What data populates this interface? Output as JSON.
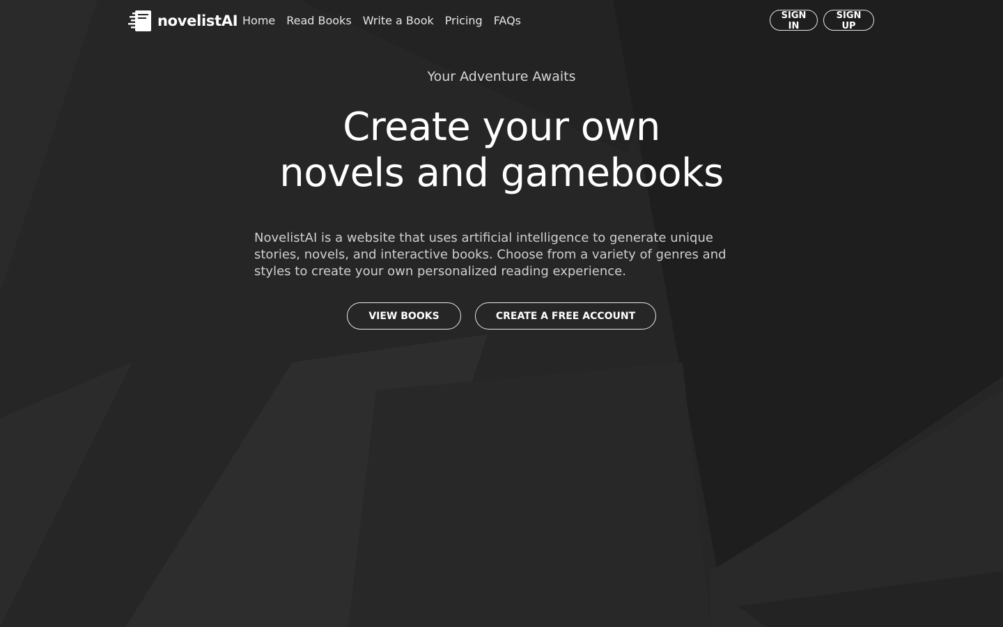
{
  "brand": {
    "name": "novelistAI",
    "icon": "book-pages-icon"
  },
  "nav": {
    "items": [
      {
        "label": "Home"
      },
      {
        "label": "Read Books"
      },
      {
        "label": "Write a Book"
      },
      {
        "label": "Pricing"
      },
      {
        "label": "FAQs"
      }
    ]
  },
  "auth": {
    "sign_in": "SIGN IN",
    "sign_up": "SIGN UP"
  },
  "hero": {
    "eyebrow": "Your Adventure Awaits",
    "headline_line1": "Create your own",
    "headline_line2": "novels and gamebooks",
    "description": "NovelistAI is a website that uses artificial intelligence to generate unique stories, novels, and interactive books. Choose from a variety of genres and styles to create your own personalized reading experience.",
    "view_books": "VIEW BOOKS",
    "create_account": "CREATE A FREE ACCOUNT"
  },
  "colors": {
    "background": "#242424",
    "text": "#ffffff",
    "muted_text": "#cfcfcf",
    "outline": "#e8e8e8"
  }
}
